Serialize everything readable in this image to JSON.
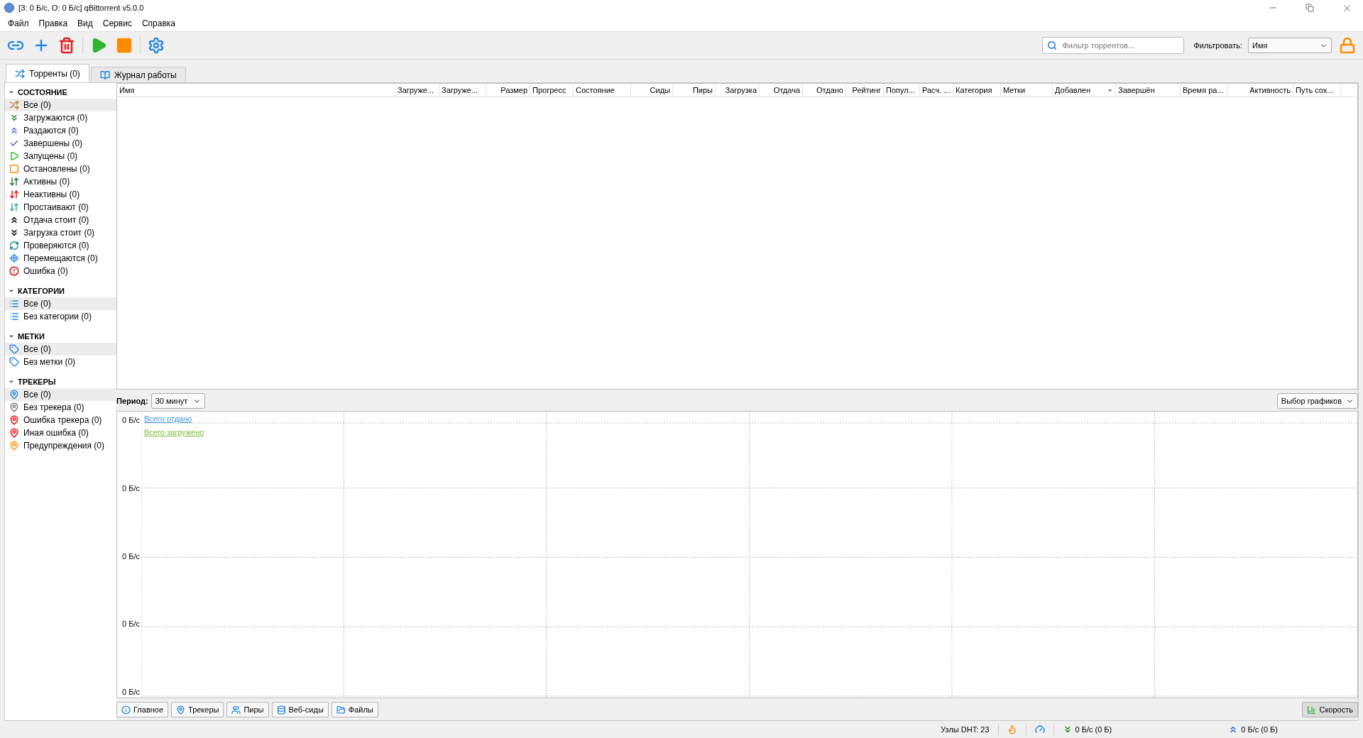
{
  "window": {
    "title": "[З: 0 Б/с, О: 0 Б/с] qBittorrent v5.0.0"
  },
  "menu": [
    "Файл",
    "Правка",
    "Вид",
    "Сервис",
    "Справка"
  ],
  "search": {
    "placeholder": "Фильтр торрентов..."
  },
  "filter": {
    "label": "Фильтровать:",
    "value": "Имя"
  },
  "tabs": [
    {
      "label": "Торренты (0)",
      "selected": true
    },
    {
      "label": "Журнал работы",
      "selected": false
    }
  ],
  "sidebar": [
    {
      "title": "СОСТОЯНИЕ",
      "expanded": true,
      "items": [
        {
          "label": "Все (0)",
          "selected": true
        },
        {
          "label": "Загружаются (0)",
          "selected": false
        },
        {
          "label": "Раздаются (0)",
          "selected": false
        },
        {
          "label": "Завершены (0)",
          "selected": false
        },
        {
          "label": "Запущены (0)",
          "selected": false
        },
        {
          "label": "Остановлены (0)",
          "selected": false
        },
        {
          "label": "Активны (0)",
          "selected": false
        },
        {
          "label": "Неактивны (0)",
          "selected": false
        },
        {
          "label": "Простаивают (0)",
          "selected": false
        },
        {
          "label": "Отдача стоит (0)",
          "selected": false
        },
        {
          "label": "Загрузка стоит (0)",
          "selected": false
        },
        {
          "label": "Проверяются (0)",
          "selected": false
        },
        {
          "label": "Перемещаются (0)",
          "selected": false
        },
        {
          "label": "Ошибка (0)",
          "selected": false
        }
      ]
    },
    {
      "title": "КАТЕГОРИИ",
      "expanded": true,
      "items": [
        {
          "label": "Все (0)",
          "selected": true
        },
        {
          "label": "Без категории (0)",
          "selected": false
        }
      ]
    },
    {
      "title": "МЕТКИ",
      "expanded": true,
      "items": [
        {
          "label": "Все (0)",
          "selected": true
        },
        {
          "label": "Без метки (0)",
          "selected": false
        }
      ]
    },
    {
      "title": "ТРЕКЕРЫ",
      "expanded": true,
      "items": [
        {
          "label": "Все (0)",
          "selected": true
        },
        {
          "label": "Без трекера (0)",
          "selected": false
        },
        {
          "label": "Ошибка трекера (0)",
          "selected": false
        },
        {
          "label": "Иная ошибка (0)",
          "selected": false
        },
        {
          "label": "Предупреждения (0)",
          "selected": false
        }
      ]
    }
  ],
  "table": {
    "columns": [
      {
        "label": "Имя",
        "sorted": false
      },
      {
        "label": "Загруже...",
        "sorted": false
      },
      {
        "label": "Загруже...",
        "sorted": false
      },
      {
        "label": "Размер",
        "sorted": false
      },
      {
        "label": "Прогресс",
        "sorted": false
      },
      {
        "label": "Состояние",
        "sorted": false
      },
      {
        "label": "Сиды",
        "sorted": false
      },
      {
        "label": "Пиры",
        "sorted": false
      },
      {
        "label": "Загрузка",
        "sorted": false
      },
      {
        "label": "Отдача",
        "sorted": false
      },
      {
        "label": "Отдано",
        "sorted": false
      },
      {
        "label": "Рейтинг",
        "sorted": false
      },
      {
        "label": "Попул...",
        "sorted": false
      },
      {
        "label": "Расч. ...",
        "sorted": false
      },
      {
        "label": "Категория",
        "sorted": false
      },
      {
        "label": "Метки",
        "sorted": false
      },
      {
        "label": "Добавлен",
        "sorted": true
      },
      {
        "label": "Завершён",
        "sorted": false
      },
      {
        "label": "Время ра...",
        "sorted": false
      },
      {
        "label": "Активность",
        "sorted": false
      },
      {
        "label": "Путь сох...",
        "sorted": false
      }
    ]
  },
  "graph": {
    "period_label": "Период:",
    "period": "30 минут",
    "select": "Выбор графиков",
    "y_labels": [
      "0 Б/с",
      "0 Б/с",
      "0 Б/с",
      "0 Б/с",
      "0 Б/с"
    ],
    "legend": [
      {
        "label": "Всего отдано",
        "color": "#3d8fe0"
      },
      {
        "label": "Всего загружено",
        "color": "#7cbb2f"
      }
    ]
  },
  "bottom_tabs": [
    {
      "label": "Главное",
      "selected": false
    },
    {
      "label": "Трекеры",
      "selected": false
    },
    {
      "label": "Пиры",
      "selected": false
    },
    {
      "label": "Веб-сиды",
      "selected": false
    },
    {
      "label": "Файлы",
      "selected": false
    }
  ],
  "speed_button": {
    "label": "Скорость",
    "selected": true
  },
  "status_bar": {
    "dht": "Узлы DHT: 23",
    "download": "0 Б/с (0 Б)",
    "upload": "0 Б/с (0 Б)"
  }
}
